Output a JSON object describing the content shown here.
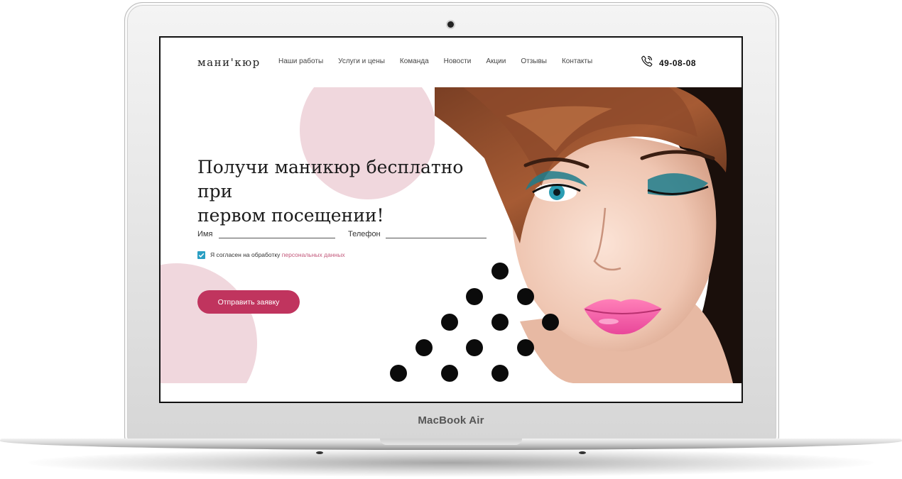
{
  "device": {
    "label": "MacBook Air"
  },
  "site": {
    "logo": "мани'кюр",
    "nav": [
      {
        "label": "Наши работы"
      },
      {
        "label": "Услуги и цены"
      },
      {
        "label": "Команда"
      },
      {
        "label": "Новости"
      },
      {
        "label": "Акции"
      },
      {
        "label": "Отзывы"
      },
      {
        "label": "Контакты"
      }
    ],
    "phone": "49-08-08"
  },
  "hero": {
    "headline_line1": "Получи маникюр бесплатно при",
    "headline_line2": "первом посещении!",
    "form": {
      "name_label": "Имя",
      "name_value": "",
      "phone_label": "Телефон",
      "phone_value": "",
      "consent_text": "Я согласен на обработку",
      "consent_link": "персональных данных",
      "consent_checked": true,
      "submit_label": "Отправить заявку"
    }
  },
  "colors": {
    "accent": "#c0345e",
    "pink_circle": "#f0d7dd",
    "checkbox": "#2a9fc3",
    "link": "#c2577a"
  },
  "icons": {
    "phone": "phone-icon",
    "check": "check-icon",
    "camera": "camera-icon"
  }
}
